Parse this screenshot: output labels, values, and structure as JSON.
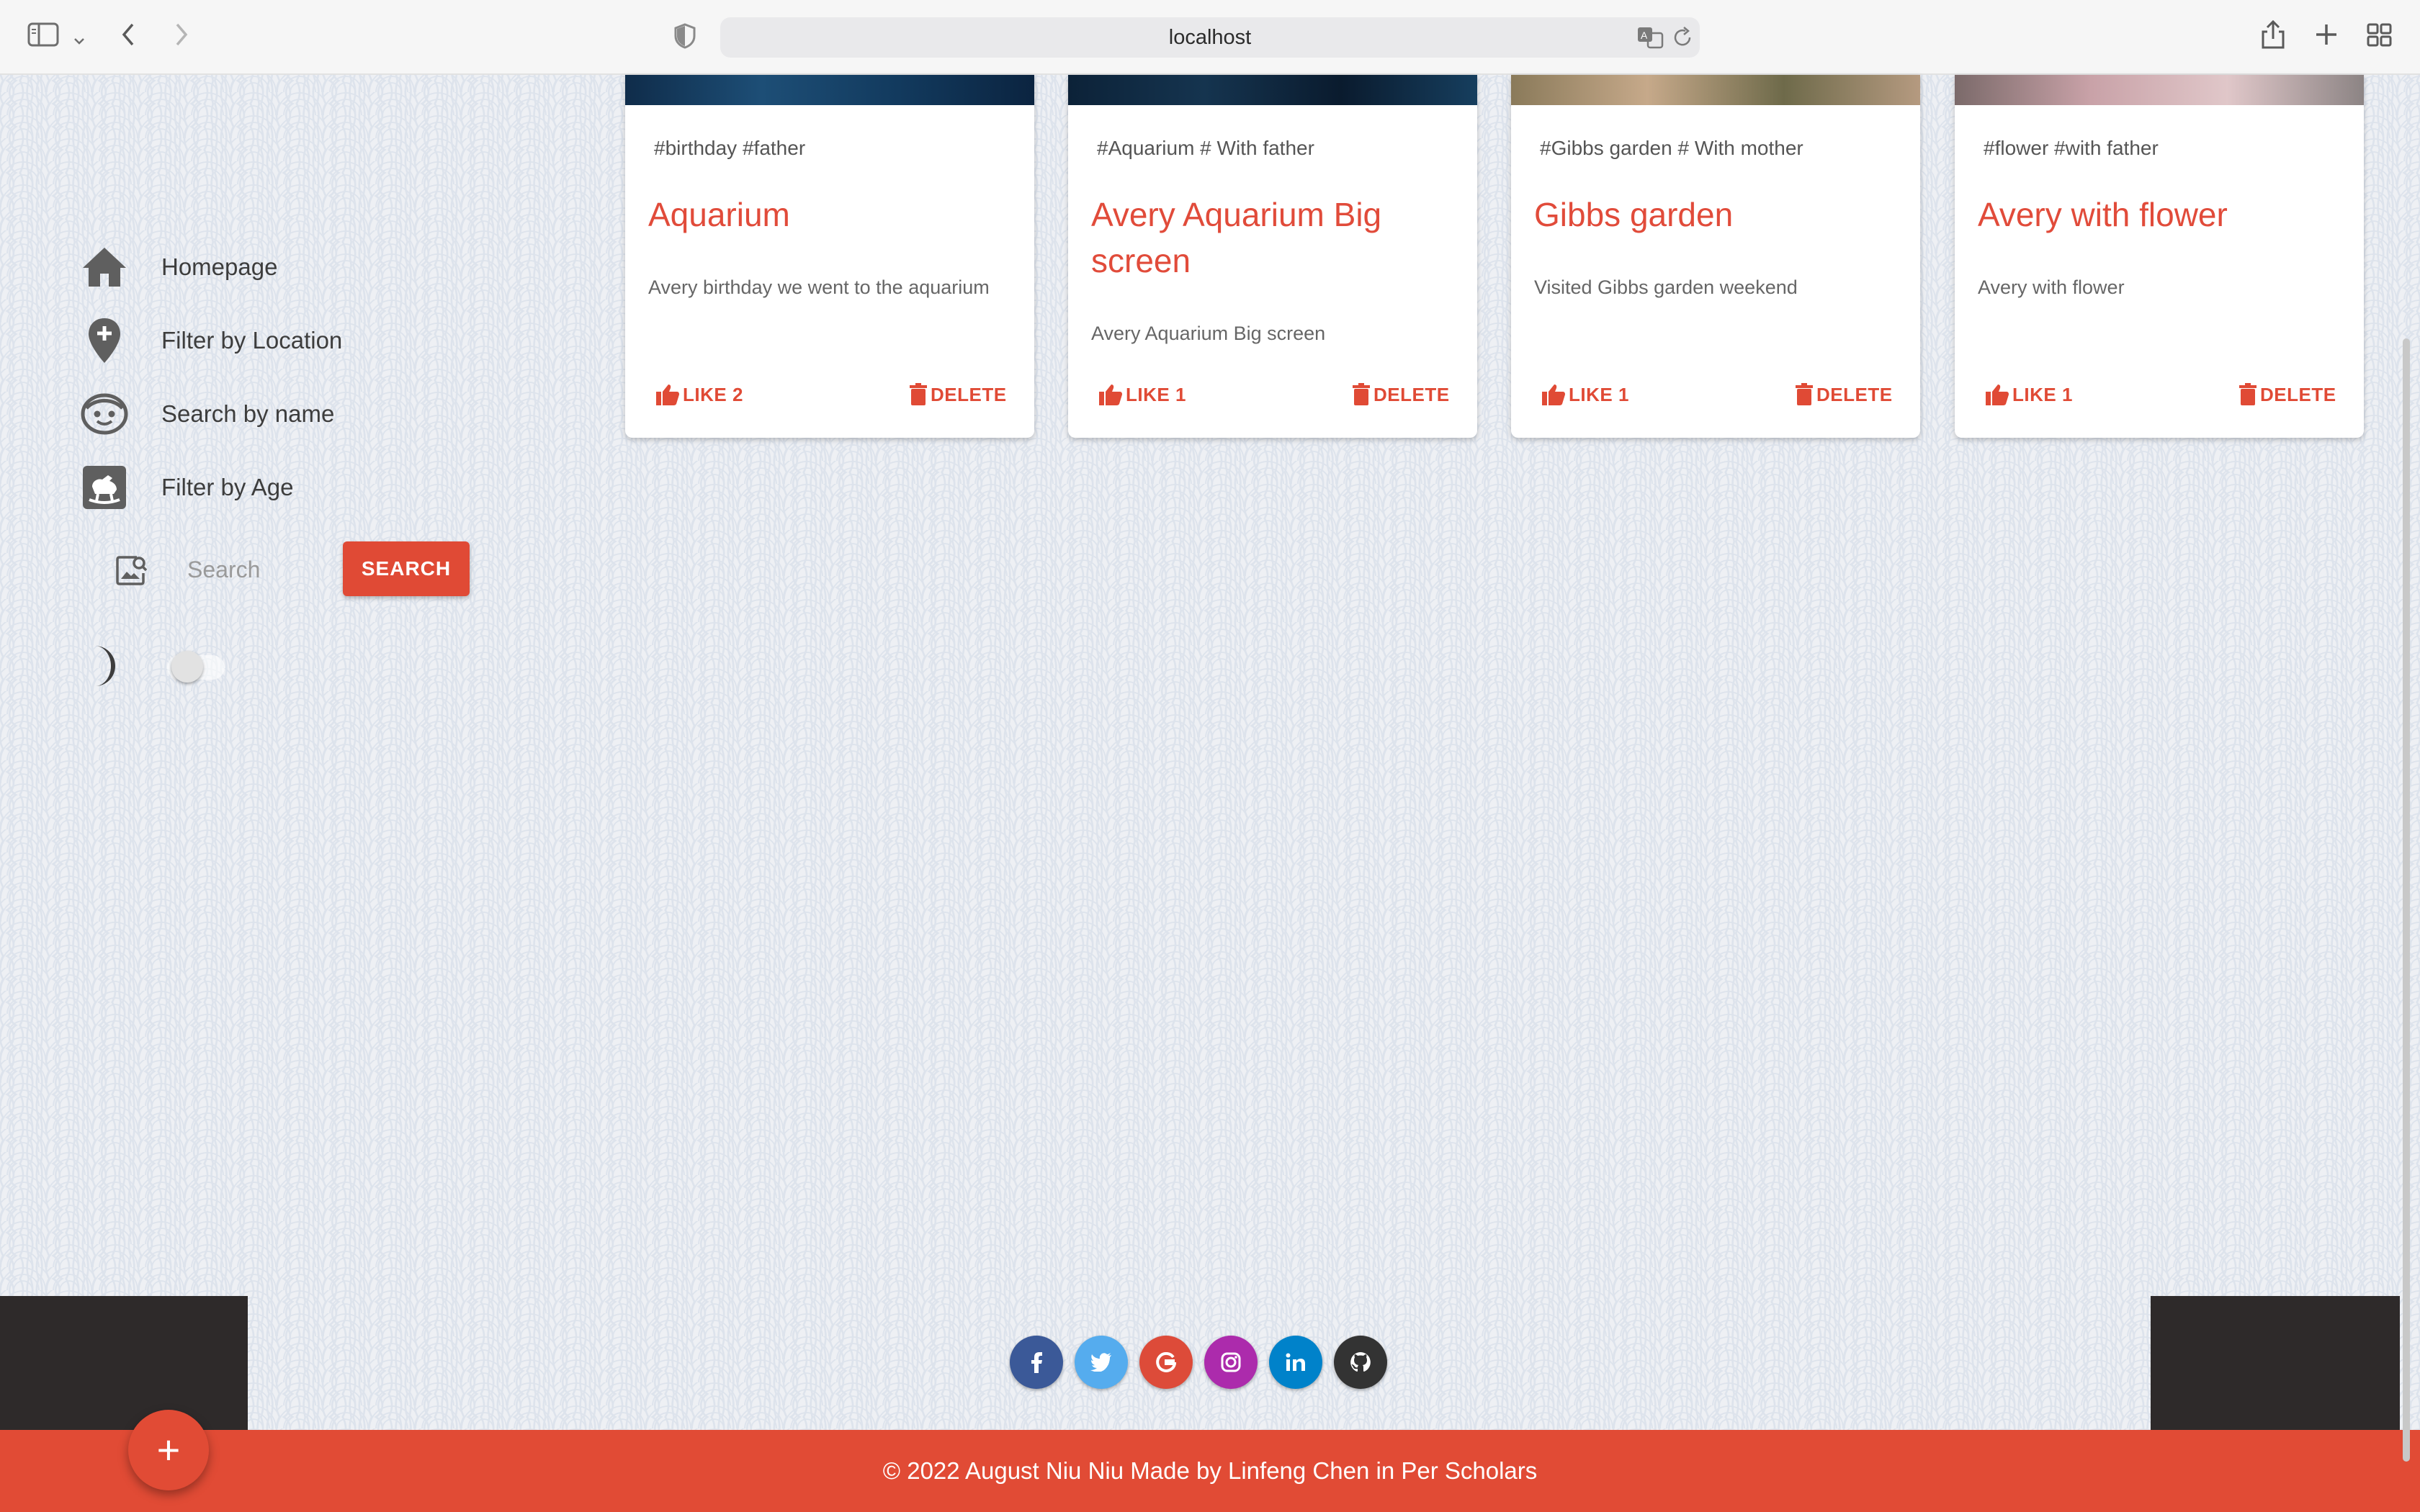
{
  "browser": {
    "url": "localhost"
  },
  "sidebar": {
    "items": [
      {
        "label": "Homepage",
        "icon": "home-icon"
      },
      {
        "label": "Filter by Location",
        "icon": "location-pin-plus-icon"
      },
      {
        "label": "Search by name",
        "icon": "face-icon"
      },
      {
        "label": "Filter by Age",
        "icon": "rocking-horse-icon"
      }
    ],
    "search": {
      "placeholder": "Search",
      "button_label": "SEARCH",
      "icon": "image-search-icon"
    },
    "dark_mode": {
      "icon": "moon-icon",
      "enabled": false
    }
  },
  "cards": [
    {
      "tags": "#birthday #father",
      "title": "Aquarium",
      "description": "Avery birthday we went to the aquarium",
      "like_label": "LIKE 2",
      "delete_label": "DELETE"
    },
    {
      "tags": "#Aquarium # With father",
      "title": "Avery Aquarium Big screen",
      "description": "Avery Aquarium Big screen",
      "like_label": "LIKE 1",
      "delete_label": "DELETE"
    },
    {
      "tags": "#Gibbs garden # With mother",
      "title": "Gibbs garden",
      "description": "Visited Gibbs garden weekend",
      "like_label": "LIKE 1",
      "delete_label": "DELETE"
    },
    {
      "tags": "#flower #with father",
      "title": "Avery with flower",
      "description": "Avery with flower",
      "like_label": "LIKE 1",
      "delete_label": "DELETE"
    }
  ],
  "social": [
    {
      "name": "facebook",
      "glyph": "f",
      "color": "#3b5998"
    },
    {
      "name": "twitter",
      "glyph": "t",
      "color": "#55acee"
    },
    {
      "name": "google",
      "glyph": "G",
      "color": "#dd4b39"
    },
    {
      "name": "instagram",
      "glyph": "◎",
      "color": "#ac2bac"
    },
    {
      "name": "linkedin",
      "glyph": "in",
      "color": "#0082ca"
    },
    {
      "name": "github",
      "glyph": "●",
      "color": "#333333"
    }
  ],
  "footer": {
    "text": "© 2022 August Niu Niu Made by Linfeng Chen in Per Scholars"
  },
  "fab": {
    "label": "+"
  },
  "colors": {
    "accent": "#e14b35",
    "footer_dark": "#2e2a2a"
  }
}
